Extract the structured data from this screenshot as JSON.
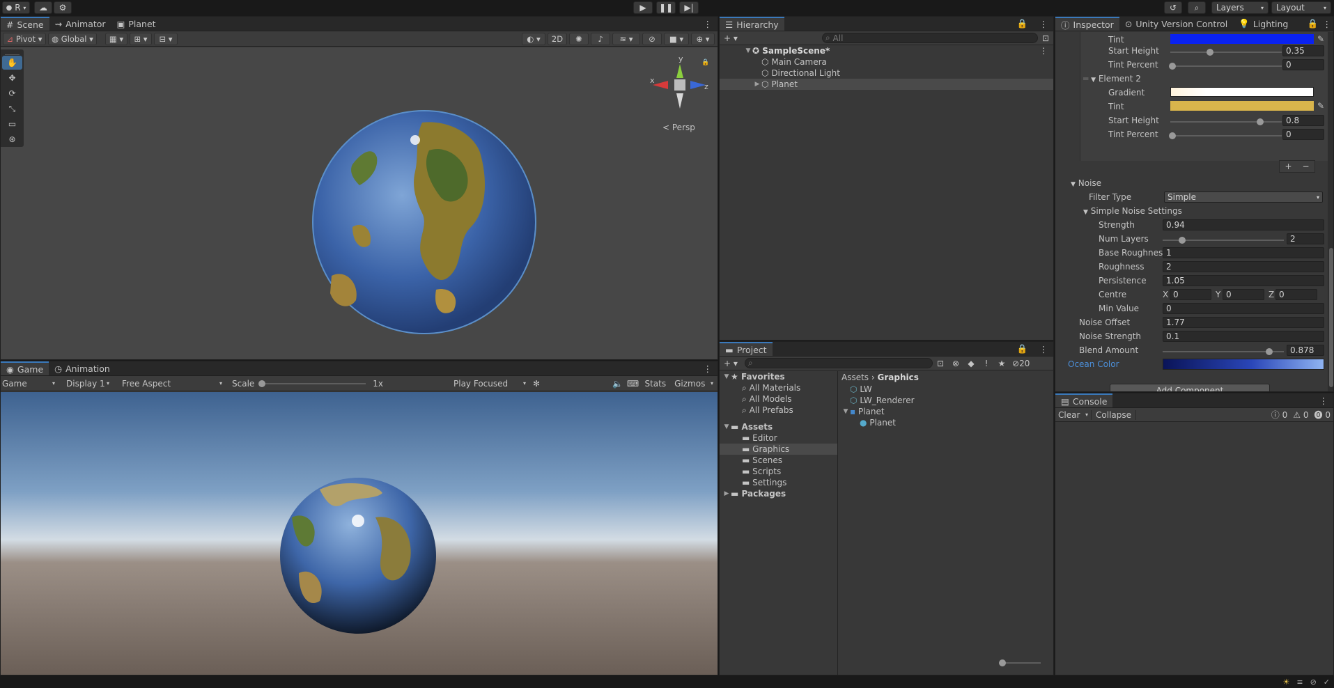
{
  "topbar": {
    "account": "R",
    "layers": "Layers",
    "layout": "Layout"
  },
  "scene": {
    "tabs": [
      "Scene",
      "Animator",
      "Planet"
    ],
    "pivot": "Pivot",
    "global": "Global",
    "mode2d": "2D",
    "persp": "Persp",
    "gizmo": {
      "x": "x",
      "y": "y",
      "z": "z"
    }
  },
  "game": {
    "tabs": [
      "Game",
      "Animation"
    ],
    "game_select": "Game",
    "display": "Display 1",
    "aspect": "Free Aspect",
    "scale_label": "Scale",
    "scale_value": "1x",
    "play_mode": "Play Focused",
    "stats": "Stats",
    "gizmos": "Gizmos"
  },
  "hierarchy": {
    "title": "Hierarchy",
    "search_placeholder": "All",
    "scene": "SampleScene*",
    "items": [
      "Main Camera",
      "Directional Light",
      "Planet"
    ]
  },
  "project": {
    "title": "Project",
    "hidden_count": "20",
    "favorites": "Favorites",
    "favorite_items": [
      "All Materials",
      "All Models",
      "All Prefabs"
    ],
    "assets": "Assets",
    "asset_folders": [
      "Editor",
      "Graphics",
      "Scenes",
      "Scripts",
      "Settings"
    ],
    "packages": "Packages",
    "breadcrumb": [
      "Assets",
      "Graphics"
    ],
    "files": [
      "LW",
      "LW_Renderer",
      "Planet",
      "Planet"
    ]
  },
  "inspector": {
    "tabs": [
      "Inspector",
      "Unity Version Control",
      "Lighting"
    ],
    "el1_tint_label": "Tint",
    "el1_tint_color": "#0a22f0",
    "el1_start_height_label": "Start Height",
    "el1_start_height": "0.35",
    "el1_tint_percent_label": "Tint Percent",
    "el1_tint_percent": "0",
    "element2": "Element 2",
    "gradient_label": "Gradient",
    "el2_tint_label": "Tint",
    "el2_tint_color": "#d9b54c",
    "el2_start_height_label": "Start Height",
    "el2_start_height": "0.8",
    "el2_tint_percent_label": "Tint Percent",
    "el2_tint_percent": "0",
    "noise": "Noise",
    "filter_type_label": "Filter Type",
    "filter_type": "Simple",
    "simple_noise": "Simple Noise Settings",
    "strength_label": "Strength",
    "strength": "0.94",
    "num_layers_label": "Num Layers",
    "num_layers": "2",
    "base_rough_label": "Base Roughness",
    "base_rough": "1",
    "rough_label": "Roughness",
    "rough": "2",
    "persist_label": "Persistence",
    "persist": "1.05",
    "centre_label": "Centre",
    "cx": "0",
    "cy": "0",
    "cz": "0",
    "x": "X",
    "y": "Y",
    "z": "Z",
    "min_value_label": "Min Value",
    "min_value": "0",
    "noise_offset_label": "Noise Offset",
    "noise_offset": "1.77",
    "noise_strength_label": "Noise Strength",
    "noise_strength": "0.1",
    "blend_label": "Blend Amount",
    "blend": "0.878",
    "ocean_label": "Ocean Color",
    "add_component": "Add Component",
    "plus": "+",
    "minus": "−"
  },
  "console": {
    "title": "Console",
    "clear": "Clear",
    "collapse": "Collapse",
    "info_count": "0",
    "warn_count": "0",
    "error_count": "0"
  }
}
